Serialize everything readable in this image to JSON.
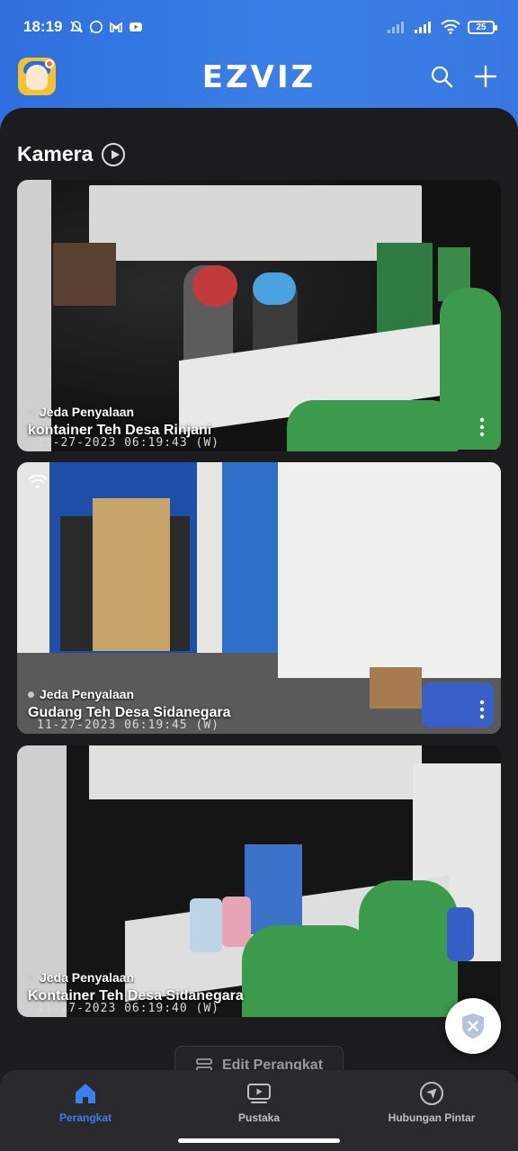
{
  "status_bar": {
    "time": "18:19",
    "battery": "25",
    "icons_left": [
      "mute-bell-icon",
      "whatsapp-icon",
      "gmail-icon",
      "youtube-icon"
    ],
    "icons_right": [
      "signal-weak-icon",
      "signal-icon",
      "wifi-icon",
      "battery-icon"
    ]
  },
  "header": {
    "logo": "EZVIZ",
    "accent_color": "#3a7fe6"
  },
  "section": {
    "title": "Kamera"
  },
  "cameras": [
    {
      "status": "Jeda Penyalaan",
      "name": "kontainer Teh Desa Rinjani",
      "timestamp": "11-27-2023 06:19:43  (W)"
    },
    {
      "status": "Jeda Penyalaan",
      "name": "Gudang Teh Desa Sidanegara",
      "timestamp": "11-27-2023 06:19:45  (W)"
    },
    {
      "status": "Jeda Penyalaan",
      "name": "Kontainer Teh Desa Sidanegara",
      "timestamp": "11-27-2023 06:19:40  (W)"
    }
  ],
  "edit_button": {
    "label": "Edit Perangkat"
  },
  "bottom_nav": {
    "items": [
      {
        "label": "Perangkat",
        "icon": "home-icon",
        "active": true
      },
      {
        "label": "Pustaka",
        "icon": "library-icon",
        "active": false
      },
      {
        "label": "Hubungan Pintar",
        "icon": "navigation-icon",
        "active": false
      }
    ],
    "active_color": "#3d7ef0"
  }
}
